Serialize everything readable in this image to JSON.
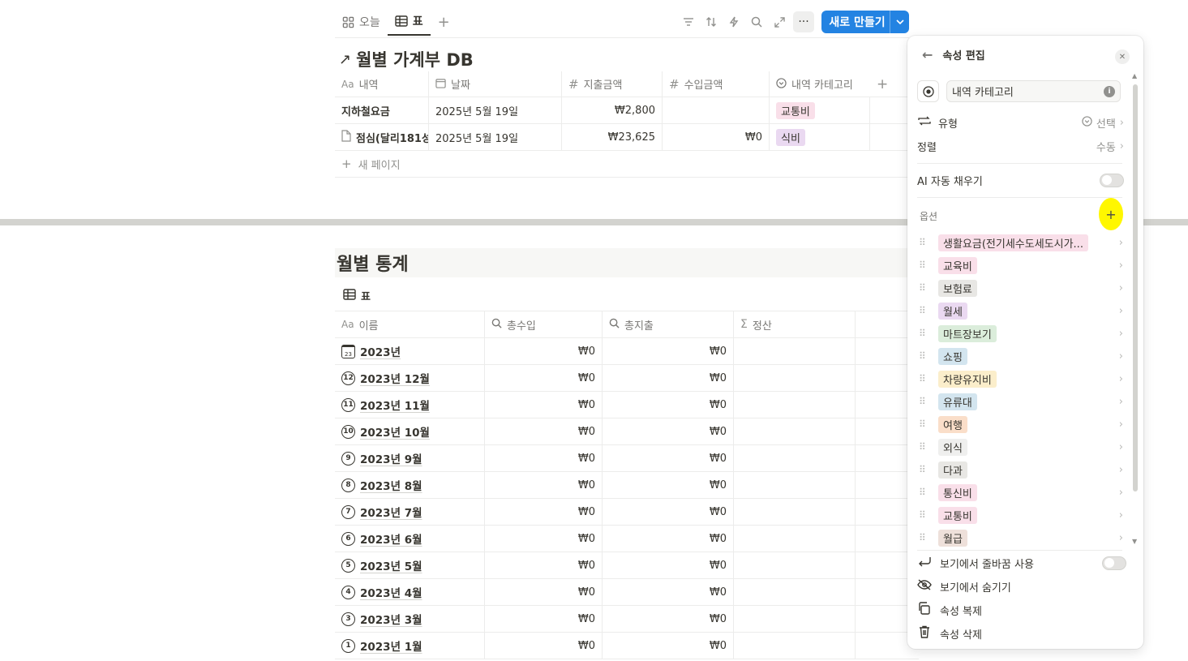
{
  "toolbar": {
    "tabs": [
      {
        "label": "오늘",
        "icon": "grid-icon"
      },
      {
        "label": "표",
        "icon": "table-icon"
      }
    ],
    "add_tab": "+",
    "new_button": "새로 만들기"
  },
  "db": {
    "title": "월별 가계부 DB",
    "columns": [
      "내역",
      "날짜",
      "지출금액",
      "수입금액",
      "내역 카테고리"
    ],
    "rows": [
      {
        "name": "지하철요금",
        "date": "2025년 5월 19일",
        "expense": "₩2,800",
        "income": "",
        "category": "교통비",
        "cat_color": "#f9dfe9"
      },
      {
        "name": "점심(달리181성",
        "date": "2025년 5월 19일",
        "expense": "₩23,625",
        "income": "₩0",
        "category": "식비",
        "cat_color": "#ead9f1"
      }
    ],
    "new_page": "새 페이지"
  },
  "stats": {
    "title": "월별 통계",
    "tab_label": "표",
    "columns": [
      "이름",
      "총수입",
      "총지출",
      "정산"
    ],
    "rows": [
      {
        "icon": "23",
        "name": "2023년",
        "income": "₩0",
        "expense": "₩0"
      },
      {
        "icon": "12",
        "name": "2023년 12월",
        "income": "₩0",
        "expense": "₩0"
      },
      {
        "icon": "11",
        "name": "2023년 11월",
        "income": "₩0",
        "expense": "₩0"
      },
      {
        "icon": "10",
        "name": "2023년 10월",
        "income": "₩0",
        "expense": "₩0"
      },
      {
        "icon": "9",
        "name": "2023년 9월",
        "income": "₩0",
        "expense": "₩0"
      },
      {
        "icon": "8",
        "name": "2023년 8월",
        "income": "₩0",
        "expense": "₩0"
      },
      {
        "icon": "7",
        "name": "2023년 7월",
        "income": "₩0",
        "expense": "₩0"
      },
      {
        "icon": "6",
        "name": "2023년 6월",
        "income": "₩0",
        "expense": "₩0"
      },
      {
        "icon": "5",
        "name": "2023년 5월",
        "income": "₩0",
        "expense": "₩0"
      },
      {
        "icon": "4",
        "name": "2023년 4월",
        "income": "₩0",
        "expense": "₩0"
      },
      {
        "icon": "3",
        "name": "2023년 3월",
        "income": "₩0",
        "expense": "₩0"
      },
      {
        "icon": "1",
        "name": "2023년 1월",
        "income": "₩0",
        "expense": "₩0"
      }
    ]
  },
  "panel": {
    "title": "속성 편집",
    "property_name": "내역 카테고리",
    "type_label": "유형",
    "type_value": "선택",
    "sort_label": "정렬",
    "sort_value": "수동",
    "ai_label": "AI 자동 채우기",
    "options_label": "옵션",
    "options": [
      {
        "label": "생활요금(전기세수도세도시가...",
        "color": "#f9dfe9"
      },
      {
        "label": "교육비",
        "color": "#f9dfe9"
      },
      {
        "label": "보험료",
        "color": "#e8e7e4"
      },
      {
        "label": "월세",
        "color": "#ead9f1"
      },
      {
        "label": "마트장보기",
        "color": "#dbeddb"
      },
      {
        "label": "쇼핑",
        "color": "#d3e5ef"
      },
      {
        "label": "차량유지비",
        "color": "#fbeecb"
      },
      {
        "label": "유류대",
        "color": "#d3e5ef"
      },
      {
        "label": "여행",
        "color": "#fadec9"
      },
      {
        "label": "외식",
        "color": "#efefee"
      },
      {
        "label": "다과",
        "color": "#e8e7e4"
      },
      {
        "label": "통신비",
        "color": "#f9dfe9"
      },
      {
        "label": "교통비",
        "color": "#f9dfe9"
      },
      {
        "label": "월급",
        "color": "#eee0da"
      }
    ],
    "bottom": [
      {
        "label": "보기에서 줄바꿈 사용",
        "icon": "wrap-icon",
        "toggle": true
      },
      {
        "label": "보기에서 숨기기",
        "icon": "eye-off-icon",
        "toggle": false
      },
      {
        "label": "속성 복제",
        "icon": "duplicate-icon",
        "toggle": false
      },
      {
        "label": "속성 삭제",
        "icon": "trash-icon",
        "toggle": false
      }
    ]
  }
}
